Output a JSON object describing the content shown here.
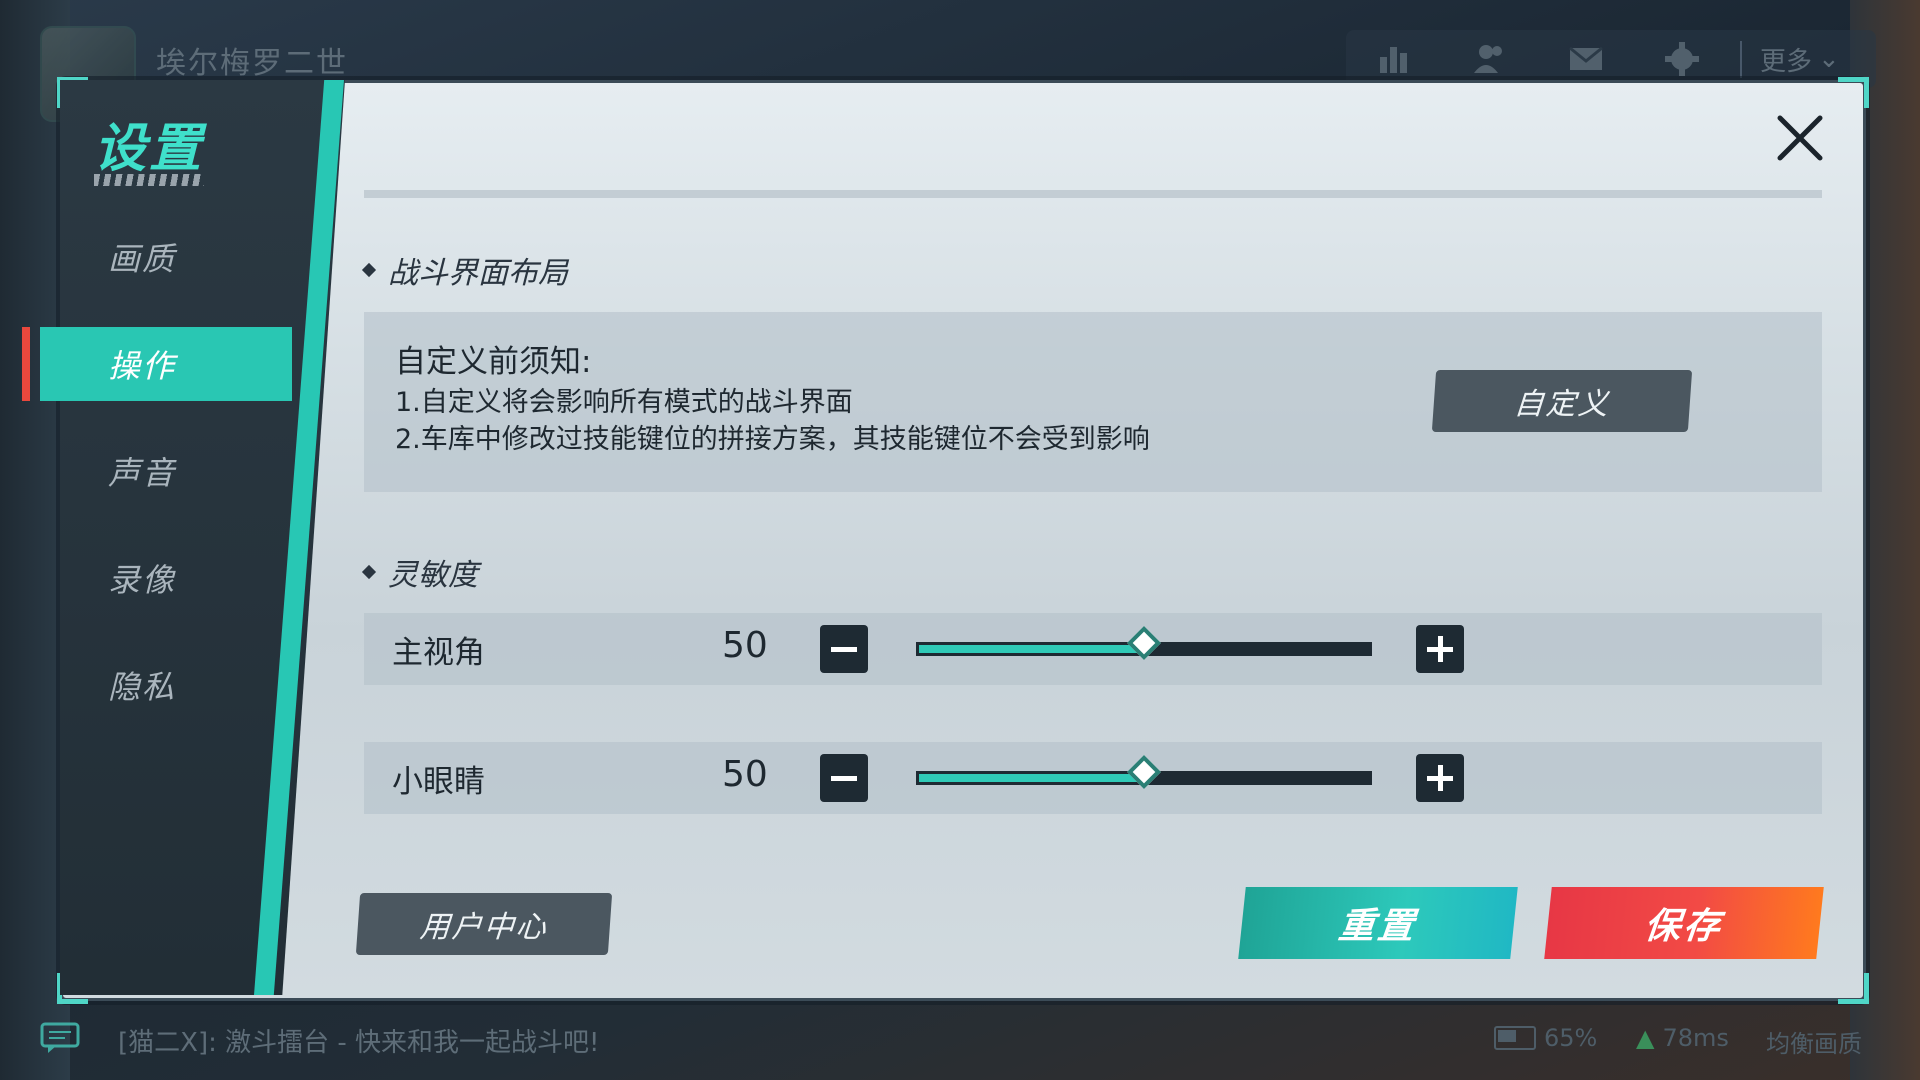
{
  "topbar": {
    "player_name": "埃尔梅罗二世",
    "more_label": "更多"
  },
  "sidebar": {
    "title": "设置",
    "items": [
      {
        "label": "画质"
      },
      {
        "label": "操作"
      },
      {
        "label": "声音"
      },
      {
        "label": "录像"
      },
      {
        "label": "隐私"
      }
    ],
    "active_index": 1
  },
  "layout_section": {
    "heading": "战斗界面布局",
    "notice_title": "自定义前须知:",
    "notice_line1": "1.自定义将会影响所有模式的战斗界面",
    "notice_line2": "2.车库中修改过技能键位的拼接方案，其技能键位不会受到影响",
    "customize_label": "自定义"
  },
  "sensitivity_section": {
    "heading": "灵敏度",
    "rows": [
      {
        "label": "主视角",
        "value": "50",
        "fraction": 0.5
      },
      {
        "label": "小眼睛",
        "value": "50",
        "fraction": 0.5
      }
    ]
  },
  "footer": {
    "user_center_label": "用户中心",
    "reset_label": "重置",
    "save_label": "保存"
  },
  "bottombar": {
    "chat_text": "[猫二X]: 激斗擂台 - 快来和我一起战斗吧!",
    "battery": "65%",
    "ping": "78ms",
    "quality": "均衡画质"
  },
  "colors": {
    "accent": "#29c7b3",
    "danger": "#e9483d"
  }
}
